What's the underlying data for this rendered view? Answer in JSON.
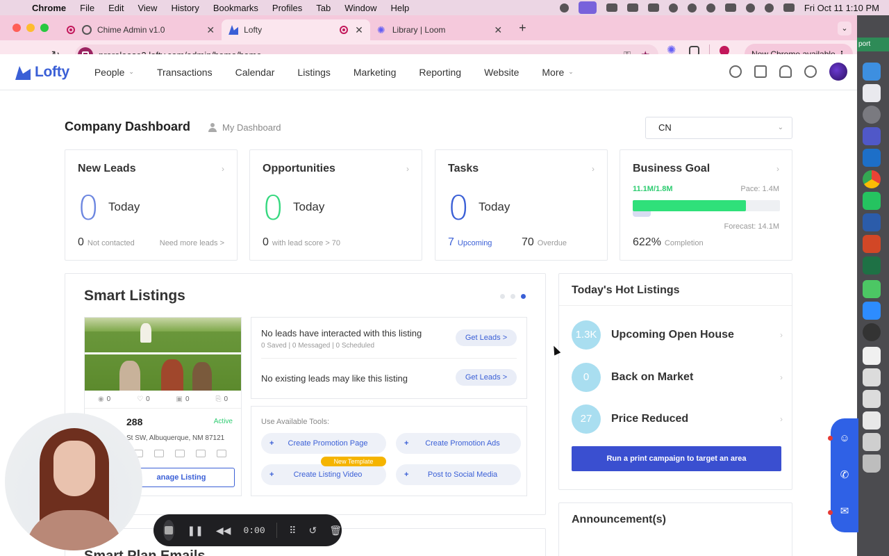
{
  "menubar": {
    "app": "Chrome",
    "items": [
      "File",
      "Edit",
      "View",
      "History",
      "Bookmarks",
      "Profiles",
      "Tab",
      "Window",
      "Help"
    ],
    "clock": "Fri Oct 11  1:10 PM"
  },
  "browser": {
    "tabs": [
      {
        "title": "Chime Admin v1.0",
        "active": false
      },
      {
        "title": "Lofty",
        "active": true
      },
      {
        "title": "Library | Loom",
        "active": false
      }
    ],
    "url": "prerelease2.lofty.com/admin/home/home",
    "new_chrome": "New Chrome available"
  },
  "app": {
    "logo": "Lofty",
    "nav": [
      {
        "label": "People",
        "dropdown": true
      },
      {
        "label": "Transactions",
        "dropdown": false
      },
      {
        "label": "Calendar",
        "dropdown": false
      },
      {
        "label": "Listings",
        "dropdown": false
      },
      {
        "label": "Marketing",
        "dropdown": false
      },
      {
        "label": "Reporting",
        "dropdown": false
      },
      {
        "label": "Website",
        "dropdown": false
      },
      {
        "label": "More",
        "dropdown": true
      }
    ]
  },
  "dashboard": {
    "title": "Company Dashboard",
    "my_dashboard": "My Dashboard",
    "region_select": "CN",
    "new_leads": {
      "title": "New Leads",
      "value": "0",
      "today": "Today",
      "not_contacted_value": "0",
      "not_contacted_label": "Not contacted",
      "link": "Need more leads >"
    },
    "opportunities": {
      "title": "Opportunities",
      "value": "0",
      "today": "Today",
      "score_value": "0",
      "score_label": "with lead score > 70"
    },
    "tasks": {
      "title": "Tasks",
      "value": "0",
      "today": "Today",
      "upcoming_value": "7",
      "upcoming_label": "Upcoming",
      "overdue_value": "70",
      "overdue_label": "Overdue"
    },
    "business_goal": {
      "title": "Business Goal",
      "progress_text": "11.1M/1.8M",
      "pace": "Pace: 1.4M",
      "forecast": "Forecast: 14.1M",
      "completion_value": "622%",
      "completion_label": "Completion",
      "bar_fill_fraction": 0.77
    }
  },
  "smart_listings": {
    "title": "Smart Listings",
    "stats": {
      "views": "0",
      "favorites": "0",
      "saves": "0",
      "shares": "0"
    },
    "price": "288",
    "status": "Active",
    "address": "St SW, Albuquerque, NM 87121",
    "manage": "anage Listing",
    "leads_row1": "No leads have interacted with this listing",
    "leads_row1_sub": "0 Saved | 0 Messaged | 0 Scheduled",
    "leads_row2": "No existing leads may like this listing",
    "get_leads": "Get Leads >",
    "tools_label": "Use Available Tools:",
    "tools": [
      "Create Promotion Page",
      "Create Promotion Ads",
      "Create Listing Video",
      "Post to Social Media"
    ],
    "new_template": "New Template"
  },
  "hot_listings": {
    "title": "Today's Hot Listings",
    "items": [
      {
        "count": "1.3K",
        "label": "Upcoming Open House"
      },
      {
        "count": "0",
        "label": "Back on Market"
      },
      {
        "count": "27",
        "label": "Price Reduced"
      }
    ],
    "campaign": "Run a print campaign to target an area"
  },
  "announcements": {
    "title": "Announcement(s)"
  },
  "smart_plan": {
    "title": "Smart Plan Emails"
  },
  "loom": {
    "time": "0:00"
  },
  "rail": {
    "badge": "port"
  },
  "colors": {
    "brand": "#3a5fd6",
    "success": "#2ecc71",
    "chrome_tint": "#f5c9dc"
  }
}
